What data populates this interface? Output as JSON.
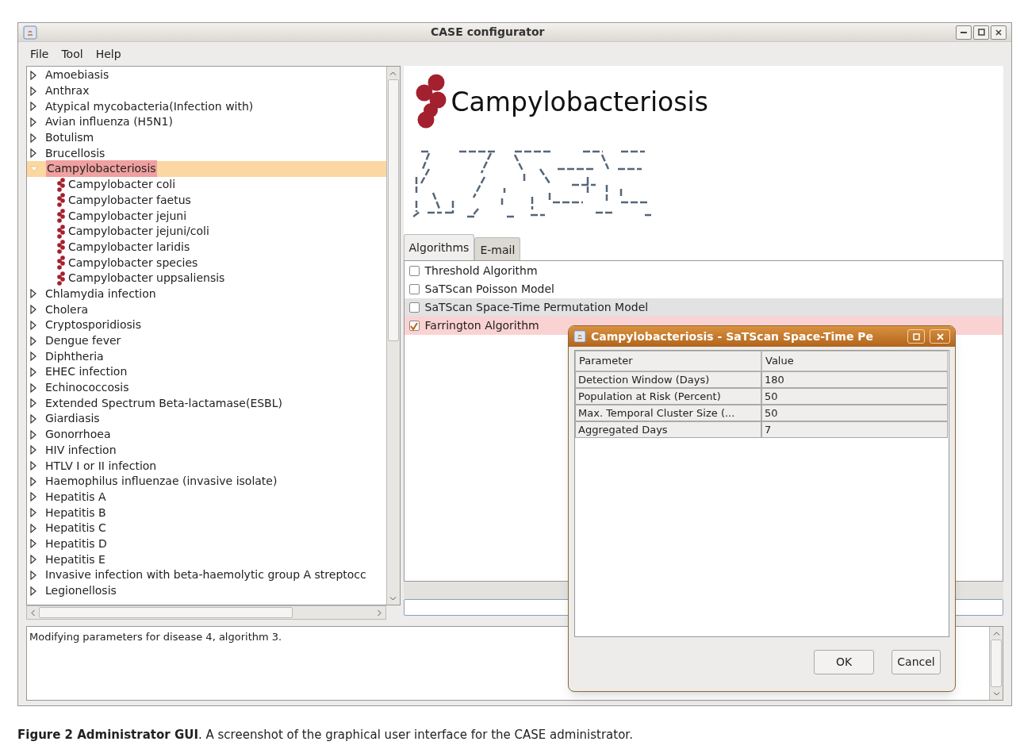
{
  "window": {
    "title": "CASE configurator",
    "menu": [
      "File",
      "Tool",
      "Help"
    ]
  },
  "tree": {
    "items": [
      {
        "label": "Amoebiasis",
        "expanded": false,
        "selected": false
      },
      {
        "label": "Anthrax",
        "expanded": false,
        "selected": false
      },
      {
        "label": "Atypical mycobacteria(Infection with)",
        "expanded": false,
        "selected": false
      },
      {
        "label": "Avian influenza (H5N1)",
        "expanded": false,
        "selected": false
      },
      {
        "label": "Botulism",
        "expanded": false,
        "selected": false
      },
      {
        "label": "Brucellosis",
        "expanded": false,
        "selected": false
      },
      {
        "label": "Campylobacteriosis",
        "expanded": true,
        "selected": true,
        "children": [
          {
            "label": "Campylobacter coli"
          },
          {
            "label": "Campylobacter faetus"
          },
          {
            "label": "Campylobacter jejuni"
          },
          {
            "label": "Campylobacter jejuni/coli"
          },
          {
            "label": "Campylobacter laridis"
          },
          {
            "label": "Campylobacter species"
          },
          {
            "label": "Campylobacter uppsaliensis"
          }
        ]
      },
      {
        "label": "Chlamydia infection",
        "expanded": false,
        "selected": false
      },
      {
        "label": "Cholera",
        "expanded": false,
        "selected": false
      },
      {
        "label": "Cryptosporidiosis",
        "expanded": false,
        "selected": false
      },
      {
        "label": "Dengue fever",
        "expanded": false,
        "selected": false
      },
      {
        "label": "Diphtheria",
        "expanded": false,
        "selected": false
      },
      {
        "label": "EHEC infection",
        "expanded": false,
        "selected": false
      },
      {
        "label": "Echinococcosis",
        "expanded": false,
        "selected": false
      },
      {
        "label": "Extended Spectrum Beta-lactamase(ESBL)",
        "expanded": false,
        "selected": false
      },
      {
        "label": "Giardiasis",
        "expanded": false,
        "selected": false
      },
      {
        "label": "Gonorrhoea",
        "expanded": false,
        "selected": false
      },
      {
        "label": "HIV infection",
        "expanded": false,
        "selected": false
      },
      {
        "label": "HTLV I or II infection",
        "expanded": false,
        "selected": false
      },
      {
        "label": "Haemophilus influenzae (invasive isolate)",
        "expanded": false,
        "selected": false
      },
      {
        "label": "Hepatitis A",
        "expanded": false,
        "selected": false
      },
      {
        "label": "Hepatitis B",
        "expanded": false,
        "selected": false
      },
      {
        "label": "Hepatitis C",
        "expanded": false,
        "selected": false
      },
      {
        "label": "Hepatitis D",
        "expanded": false,
        "selected": false
      },
      {
        "label": "Hepatitis E",
        "expanded": false,
        "selected": false
      },
      {
        "label": "Invasive infection with beta-haemolytic group A streptocc",
        "expanded": false,
        "selected": false
      },
      {
        "label": "Legionellosis",
        "expanded": false,
        "selected": false
      }
    ]
  },
  "detail": {
    "title": "Campylobacteriosis",
    "tabs": [
      {
        "label": "Algorithms",
        "selected": true
      },
      {
        "label": "E-mail",
        "selected": false
      }
    ],
    "algorithms": [
      {
        "label": "Threshold Algorithm",
        "checked": false,
        "selected": false,
        "hovered": false
      },
      {
        "label": "SaTScan Poisson Model",
        "checked": false,
        "selected": false,
        "hovered": false
      },
      {
        "label": "SaTScan Space-Time Permutation Model",
        "checked": false,
        "selected": false,
        "hovered": true
      },
      {
        "label": "Farrington Algorithm",
        "checked": true,
        "selected": true,
        "hovered": false
      }
    ]
  },
  "log": {
    "text": "Modifying parameters for disease 4, algorithm 3."
  },
  "dialog": {
    "title": "Campylobacteriosis - SaTScan Space-Time Pe",
    "columns": [
      "Parameter",
      "Value"
    ],
    "rows": [
      [
        "Detection Window (Days)",
        "180"
      ],
      [
        "Population at Risk (Percent)",
        "50"
      ],
      [
        "Max. Temporal Cluster Size (...",
        "50"
      ],
      [
        "Aggregated Days",
        "7"
      ]
    ],
    "buttons": [
      "OK",
      "Cancel"
    ]
  },
  "caption": "**Figure 2 Administrator GUI**. A screenshot of the graphical user interface for the CASE administrator."
}
